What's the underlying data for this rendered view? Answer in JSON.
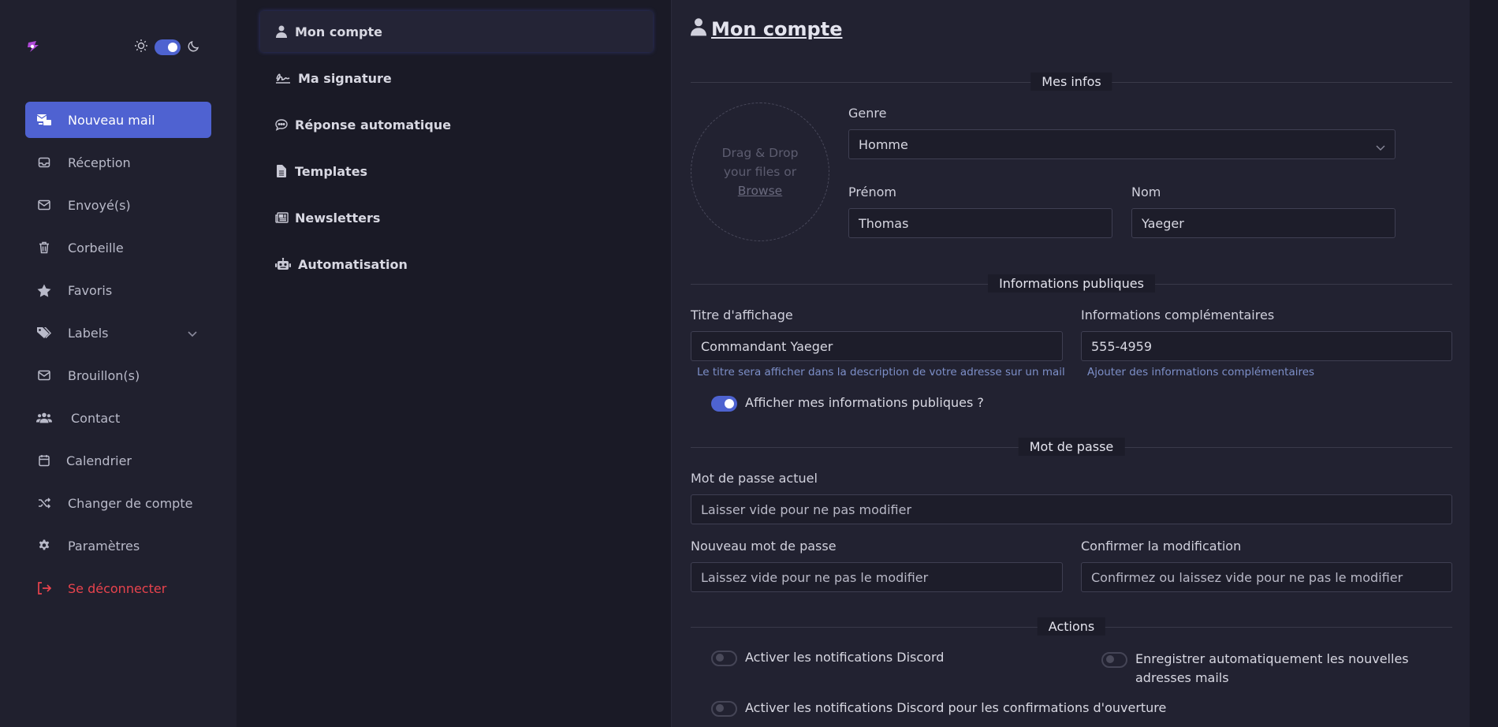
{
  "theme": {
    "mode": "dark",
    "accent": "#4f62d1",
    "danger": "#e8434d"
  },
  "sidebar": {
    "items": [
      {
        "label": "Nouveau mail",
        "icon": "compose-mail-icon"
      },
      {
        "label": "Réception",
        "icon": "inbox-icon"
      },
      {
        "label": "Envoyé(s)",
        "icon": "envelope-icon"
      },
      {
        "label": "Corbeille",
        "icon": "trash-icon"
      },
      {
        "label": "Favoris",
        "icon": "star-icon"
      },
      {
        "label": "Labels",
        "icon": "tags-icon"
      },
      {
        "label": "Brouillon(s)",
        "icon": "envelope-icon"
      },
      {
        "label": "Contact",
        "icon": "users-icon"
      },
      {
        "label": "Calendrier",
        "icon": "calendar-icon"
      },
      {
        "label": "Changer de compte",
        "icon": "shuffle-icon"
      },
      {
        "label": "Paramètres",
        "icon": "gear-icon"
      },
      {
        "label": "Se déconnecter",
        "icon": "logout-icon"
      }
    ]
  },
  "menu": {
    "items": [
      {
        "label": "Mon compte",
        "icon": "user-icon"
      },
      {
        "label": "Ma signature",
        "icon": "signature-icon"
      },
      {
        "label": "Réponse automatique",
        "icon": "comment-icon"
      },
      {
        "label": "Templates",
        "icon": "file-icon"
      },
      {
        "label": "Newsletters",
        "icon": "newspaper-icon"
      },
      {
        "label": "Automatisation",
        "icon": "robot-icon"
      }
    ]
  },
  "page": {
    "title": "Mon compte",
    "sections": {
      "infos": "Mes infos",
      "public": "Informations publiques",
      "password": "Mot de passe",
      "actions": "Actions"
    },
    "dropzone": {
      "text": "Drag & Drop your files or",
      "link": "Browse"
    },
    "genre": {
      "label": "Genre",
      "value": "Homme"
    },
    "prenom": {
      "label": "Prénom",
      "value": "Thomas"
    },
    "nom": {
      "label": "Nom",
      "value": "Yaeger"
    },
    "titre": {
      "label": "Titre d'affichage",
      "value": "Commandant Yaeger",
      "hint": "Le titre sera afficher dans la description de votre adresse sur un mail"
    },
    "complement": {
      "label": "Informations complémentaires",
      "value": "555-4959",
      "hint": "Ajouter des informations complémentaires"
    },
    "public_toggle": "Afficher mes informations publiques ?",
    "current_password": {
      "label": "Mot de passe actuel",
      "placeholder": "Laisser vide pour ne pas modifier"
    },
    "new_password": {
      "label": "Nouveau mot de passe",
      "placeholder": "Laissez vide pour ne pas le modifier"
    },
    "confirm_password": {
      "label": "Confirmer la modification",
      "placeholder": "Confirmez ou laissez vide pour ne pas le modifier"
    },
    "actions": {
      "discord": "Activer les notifications Discord",
      "auto_save": "Enregistrer automatiquement les nouvelles adresses mails",
      "discord_open": "Activer les notifications Discord pour les confirmations d'ouverture"
    }
  }
}
